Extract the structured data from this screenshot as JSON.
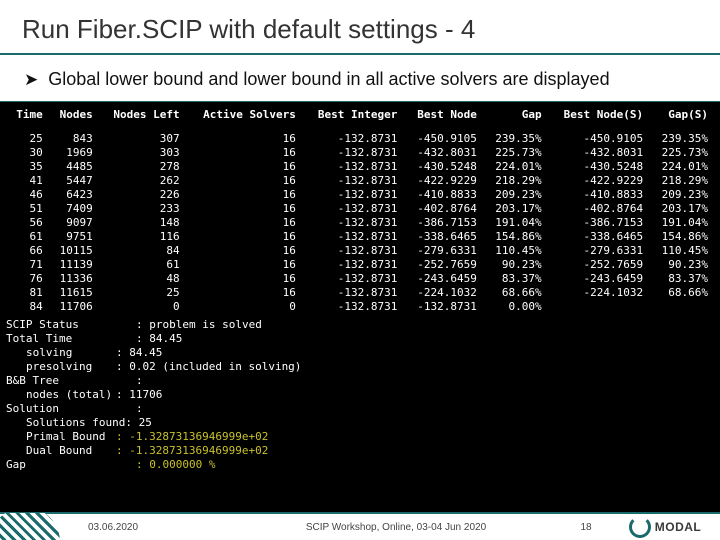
{
  "title": "Run Fiber.SCIP with default settings - 4",
  "bullet": "Global lower bound and lower bound in all active solvers are displayed",
  "columns": [
    "Time",
    "Nodes",
    "Nodes Left",
    "Active Solvers",
    "Best Integer",
    "Best Node",
    "Gap",
    "Best Node(S)",
    "Gap(S)"
  ],
  "rows": [
    [
      "25",
      "843",
      "307",
      "16",
      "-132.8731",
      "-450.9105",
      "239.35%",
      "-450.9105",
      "239.35%"
    ],
    [
      "30",
      "1969",
      "303",
      "16",
      "-132.8731",
      "-432.8031",
      "225.73%",
      "-432.8031",
      "225.73%"
    ],
    [
      "35",
      "4485",
      "278",
      "16",
      "-132.8731",
      "-430.5248",
      "224.01%",
      "-430.5248",
      "224.01%"
    ],
    [
      "41",
      "5447",
      "262",
      "16",
      "-132.8731",
      "-422.9229",
      "218.29%",
      "-422.9229",
      "218.29%"
    ],
    [
      "46",
      "6423",
      "226",
      "16",
      "-132.8731",
      "-410.8833",
      "209.23%",
      "-410.8833",
      "209.23%"
    ],
    [
      "51",
      "7409",
      "233",
      "16",
      "-132.8731",
      "-402.8764",
      "203.17%",
      "-402.8764",
      "203.17%"
    ],
    [
      "56",
      "9097",
      "148",
      "16",
      "-132.8731",
      "-386.7153",
      "191.04%",
      "-386.7153",
      "191.04%"
    ],
    [
      "61",
      "9751",
      "116",
      "16",
      "-132.8731",
      "-338.6465",
      "154.86%",
      "-338.6465",
      "154.86%"
    ],
    [
      "66",
      "10115",
      "84",
      "16",
      "-132.8731",
      "-279.6331",
      "110.45%",
      "-279.6331",
      "110.45%"
    ],
    [
      "71",
      "11139",
      "61",
      "16",
      "-132.8731",
      "-252.7659",
      "90.23%",
      "-252.7659",
      "90.23%"
    ],
    [
      "76",
      "11336",
      "48",
      "16",
      "-132.8731",
      "-243.6459",
      "83.37%",
      "-243.6459",
      "83.37%"
    ],
    [
      "81",
      "11615",
      "25",
      "16",
      "-132.8731",
      "-224.1032",
      "68.66%",
      "-224.1032",
      "68.66%"
    ],
    [
      "84",
      "11706",
      "0",
      "0",
      "-132.8731",
      "-132.8731",
      "0.00%",
      "",
      ""
    ]
  ],
  "status": [
    {
      "k": "SCIP Status",
      "v": ": problem is solved",
      "sub": false,
      "yel": false
    },
    {
      "k": "Total Time",
      "v": ": 84.45",
      "sub": false,
      "yel": false
    },
    {
      "k": "solving",
      "v": ": 84.45",
      "sub": true,
      "yel": false
    },
    {
      "k": "presolving",
      "v": ": 0.02 (included in solving)",
      "sub": true,
      "yel": false
    },
    {
      "k": "B&B Tree",
      "v": ":",
      "sub": false,
      "yel": false
    },
    {
      "k": "nodes (total)",
      "v": ": 11706",
      "sub": true,
      "yel": false
    },
    {
      "k": "Solution",
      "v": ":",
      "sub": false,
      "yel": false
    },
    {
      "k": "Solutions found",
      "v": ": 25",
      "sub": true,
      "yel": false
    },
    {
      "k": "Primal Bound",
      "v": ": -1.32873136946999e+02",
      "sub": true,
      "yel": true
    },
    {
      "k": "Dual Bound",
      "v": ": -1.32873136946999e+02",
      "sub": true,
      "yel": true
    },
    {
      "k": "Gap",
      "v": ": 0.000000 %",
      "sub": false,
      "yel": true
    }
  ],
  "footer": {
    "date": "03.06.2020",
    "mid": "SCIP Workshop, Online, 03-04 Jun 2020",
    "page": "18",
    "logo": "MODAL"
  }
}
